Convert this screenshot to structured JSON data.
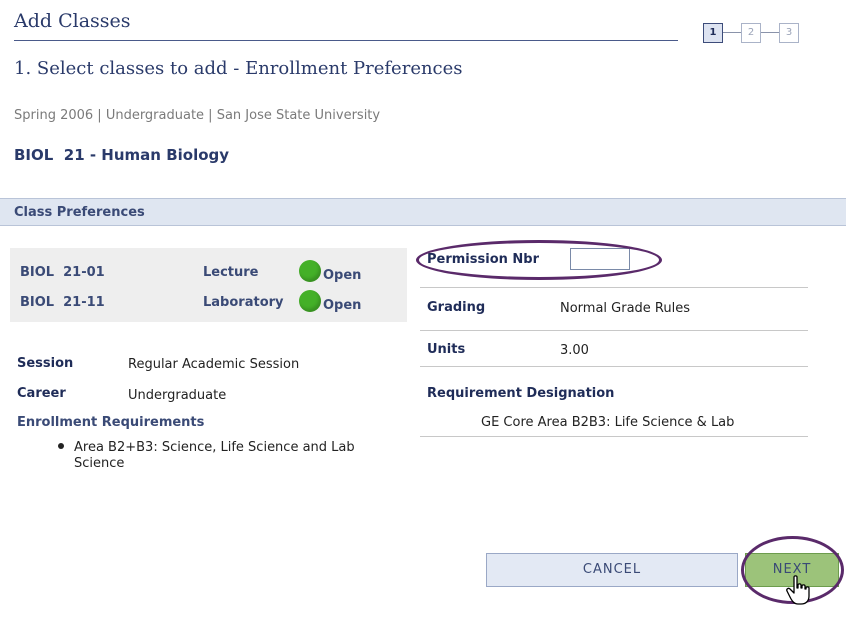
{
  "header": {
    "title": "Add Classes",
    "steps": [
      "1",
      "2",
      "3"
    ],
    "active_step": 1,
    "subtitle": "1. Select classes to add - Enrollment Preferences",
    "term_info": "Spring 2006 | Undergraduate | San Jose State University",
    "course_title": "BIOL  21 - Human Biology"
  },
  "section": {
    "title": "Class Preferences"
  },
  "classes": [
    {
      "number": "BIOL  21-01",
      "component": "Lecture",
      "status": "Open"
    },
    {
      "number": "BIOL  21-11",
      "component": "Laboratory",
      "status": "Open"
    }
  ],
  "details": {
    "session_label": "Session",
    "session_value": "Regular Academic Session",
    "career_label": "Career",
    "career_value": "Undergraduate",
    "enrollment_req_label": "Enrollment Requirements",
    "enrollment_req_item": "Area B2+B3: Science, Life Science and Lab Science"
  },
  "preferences": {
    "permission_label": "Permission Nbr",
    "permission_value": "",
    "grading_label": "Grading",
    "grading_value": "Normal Grade Rules",
    "units_label": "Units",
    "units_value": "3.00",
    "requirement_label": "Requirement Designation",
    "requirement_value": "GE Core Area B2B3: Life Science & Lab"
  },
  "buttons": {
    "cancel": "CANCEL",
    "next": "NEXT"
  },
  "colors": {
    "heading": "#2a3a6a",
    "status_open": "#44b028",
    "highlight_oval": "#5a2a6a",
    "next_button": "#9cc37a"
  }
}
